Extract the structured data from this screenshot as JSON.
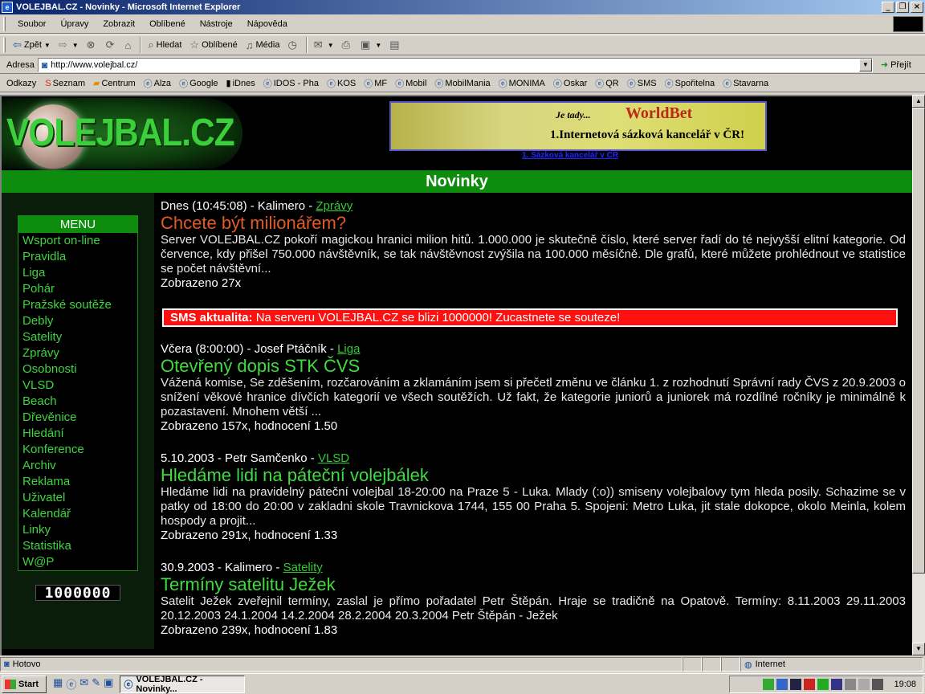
{
  "window": {
    "title": "VOLEJBAL.CZ - Novinky - Microsoft Internet Explorer"
  },
  "menubar": {
    "items": [
      "Soubor",
      "Úpravy",
      "Zobrazit",
      "Oblíbené",
      "Nástroje",
      "Nápověda"
    ]
  },
  "toolbar": {
    "back_label": "Zpět",
    "search_label": "Hledat",
    "favorites_label": "Oblíbené",
    "media_label": "Média"
  },
  "addressbar": {
    "label": "Adresa",
    "url": "http://www.volejbal.cz/",
    "go_label": "Přejít"
  },
  "linksbar": {
    "label": "Odkazy",
    "links": [
      "Seznam",
      "Centrum",
      "Alza",
      "Google",
      "iDnes",
      "IDOS - Pha",
      "KOS",
      "MF",
      "Mobil",
      "MobilMania",
      "MONIMA",
      "Oskar",
      "QR",
      "SMS",
      "Spořitelna",
      "Stavarna"
    ]
  },
  "page": {
    "logo_text": "VOLEJBAL.CZ",
    "banner": {
      "line1": "Je tady...",
      "brand": "WorldBet",
      "line2": "1.Internetová sázková kancelář v ČR!",
      "link": "1. Sázková kancelář v ČR"
    },
    "section_title": "Novinky",
    "menu": {
      "title": "MENU",
      "items": [
        "Wsport on-line",
        "Pravidla",
        "Liga",
        "Pohár",
        "Pražské soutěže",
        "Debly",
        "Satelity",
        "Zprávy",
        "Osobnosti",
        "VLSD",
        "Beach",
        "Dřevěnice",
        "Hledání",
        "Konference",
        "Archiv",
        "Reklama",
        "Uživatel",
        "Kalendář",
        "Linky",
        "Statistika",
        "W@P"
      ]
    },
    "counter": "1000000",
    "articles": [
      {
        "meta": "Dnes (10:45:08) - Kalimero - ",
        "category": "Zprávy",
        "headline": "Chcete být milionářem?",
        "headline_color": "#e35a24",
        "body": "Server VOLEJBAL.CZ pokoří magickou hranici milion hitů. 1.000.000 je skutečně číslo, které server řadí do té nejvyšší elitní kategorie. Od července, kdy přišel 750.000 návštěvník, se tak návštěvnost zvýšila na 100.000 měsíčně. Dle grafů, které můžete prohlédnout ve statistice se počet návštěvní...",
        "views": "Zobrazeno 27x"
      },
      {
        "meta": "Včera (8:00:00) - Josef Ptáčník - ",
        "category": "Liga",
        "headline": "Otevřený dopis STK ČVS",
        "headline_color": "#3fdb3f",
        "body": "Vážená komise, Se zděšením, rozčarováním a zklamáním jsem si přečetl změnu ve článku 1. z rozhodnutí Správní rady ČVS z 20.9.2003 o snížení věkové hranice dívčích kategorií ve všech soutěžích. Už fakt, že kategorie juniorů a juniorek má rozdílné ročníky je minimálně k pozastavení. Mnohem větší ...",
        "views": "Zobrazeno 157x, hodnocení 1.50"
      },
      {
        "meta": "5.10.2003 - Petr Samčenko - ",
        "category": "VLSD",
        "headline": "Hledáme lidi na páteční volejbálek",
        "headline_color": "#3fdb3f",
        "body": "Hledáme lidi na pravidelný páteční volejbal 18-20:00 na Praze 5 - Luka. Mlady (:o)) smiseny volejbalovy tym hleda posily. Schazime se v patky od 18:00 do 20:00 v zakladni skole Travnickova 1744, 155 00 Praha 5. Spojeni: Metro Luka, jit stale dokopce, okolo Meinla, kolem hospody a projit...",
        "views": "Zobrazeno 291x, hodnocení 1.33"
      },
      {
        "meta": "30.9.2003 - Kalimero - ",
        "category": "Satelity",
        "headline": "Termíny satelitu Ježek",
        "headline_color": "#3fdb3f",
        "body": "Satelit Ježek zveřejnil termíny, zaslal je přímo pořadatel Petr Štěpán. Hraje se tradičně na Opatově. Termíny: 8.11.2003 29.11.2003 20.12.2003 24.1.2004 14.2.2004 28.2.2004 20.3.2004 Petr Štěpán - Ježek",
        "views": "Zobrazeno 239x, hodnocení 1.83"
      }
    ],
    "sms": {
      "label": "SMS aktualita:",
      "message": "Na serveru VOLEJBAL.CZ se blizi 1000000! Zucastnete se souteze!"
    }
  },
  "statusbar": {
    "status": "Hotovo",
    "zone": "Internet"
  },
  "taskbar": {
    "start_label": "Start",
    "task_label": "VOLEJBAL.CZ - Novinky...",
    "clock": "19:08"
  }
}
